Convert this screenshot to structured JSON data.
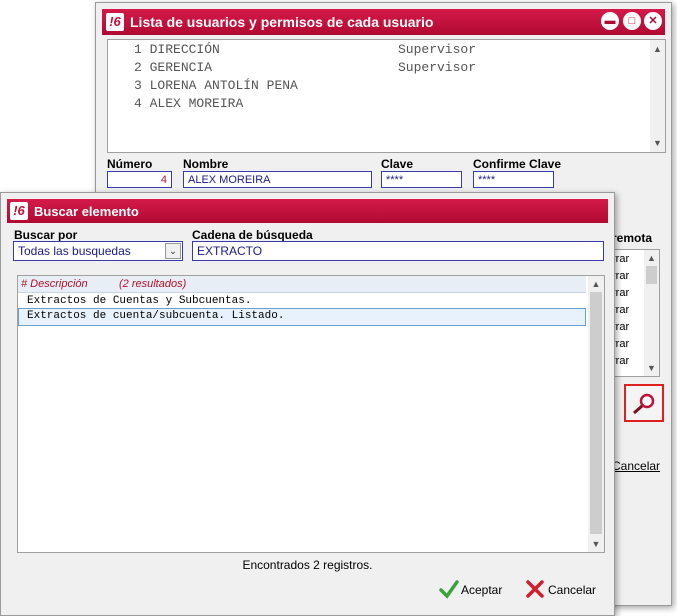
{
  "user_window": {
    "title": "Lista de usuarios y permisos de cada usuario",
    "users": [
      {
        "num": "1",
        "name": "DIRECCIÓN",
        "role": "Supervisor"
      },
      {
        "num": "2",
        "name": "GERENCIA",
        "role": "Supervisor"
      },
      {
        "num": "3",
        "name": "LORENA ANTOLÍN PENA",
        "role": ""
      },
      {
        "num": "4",
        "name": "ALEX MOREIRA",
        "role": ""
      }
    ],
    "labels": {
      "numero": "Número",
      "nombre": "Nombre",
      "clave": "Clave",
      "confirme": "Confirme Clave",
      "remota": "remota"
    },
    "values": {
      "numero": "4",
      "nombre": "ALEX MOREIRA",
      "clave": "****",
      "confirme": "****"
    },
    "perm_items": [
      "rrar",
      "rrar",
      "rrar",
      "rrar",
      "rrar",
      "rrar",
      "rrar"
    ],
    "cancel_label": "Cancelar"
  },
  "search_dialog": {
    "title": "Buscar elemento",
    "buscar_por_label": "Buscar por",
    "buscar_por_value": "Todas las busquedas",
    "cadena_label": "Cadena de búsqueda",
    "cadena_value": "EXTRACTO",
    "header_desc": "# Descripción",
    "header_count": "(2 resultados)",
    "results": [
      "Extractos de Cuentas y Subcuentas.",
      "Extractos de cuenta/subcuenta. Listado."
    ],
    "status": "Encontrados 2 registros.",
    "accept": "Aceptar",
    "cancel": "Cancelar"
  },
  "colors": {
    "accent": "#c0103a",
    "field_border": "#3a3ab0",
    "selection": "#e8f2fc"
  }
}
